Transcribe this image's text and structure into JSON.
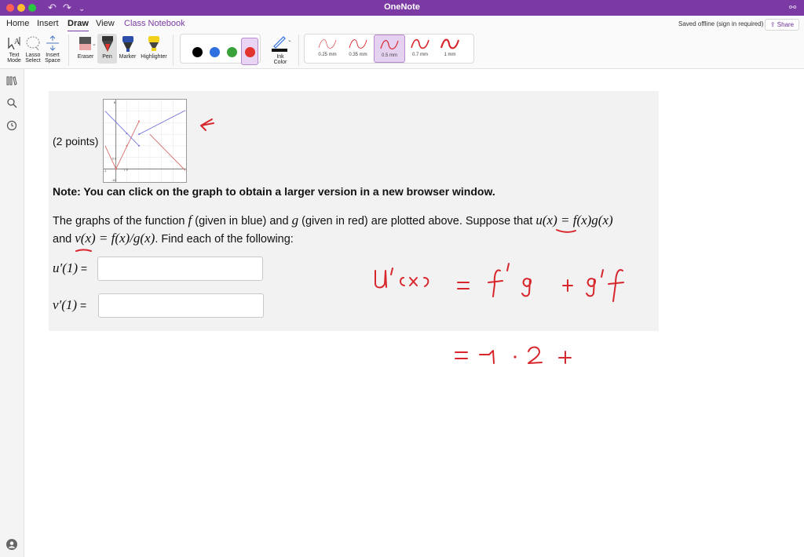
{
  "window": {
    "title": "OneNote"
  },
  "tabs": [
    "Home",
    "Insert",
    "Draw",
    "View",
    "Class Notebook"
  ],
  "active_tab": "Draw",
  "status": {
    "saved": "Saved offline (sign in required)",
    "share": "Share"
  },
  "ribbon": {
    "text_mode": [
      "Text",
      "Mode"
    ],
    "lasso_select": [
      "Lasso",
      "Select"
    ],
    "insert_space": [
      "Insert",
      "Space"
    ],
    "eraser": "Eraser",
    "pen": "Pen",
    "marker": "Marker",
    "highlighter": "Highlighter",
    "ink_color": [
      "Ink",
      "Color"
    ],
    "colors": [
      "#000000",
      "#2f6fe0",
      "#3aa23a",
      "#e2332c"
    ],
    "selected_color": "#e2332c",
    "thickness": [
      "0.25 mm",
      "0.35 mm",
      "0.5 mm",
      "0.7 mm",
      "1 mm"
    ],
    "selected_thickness": "0.5 mm"
  },
  "page": {
    "points": "(2 points)",
    "note": "Note: You can click on the graph to obtain a larger version in a new browser window.",
    "p1_a": "The graphs of the function ",
    "f": "f",
    "p1_b": " (given in blue) and ",
    "g": "g",
    "p1_c": " (given in red) are plotted above. Suppose that ",
    "u_def": "u(x) = f(x)g(x)",
    "p2_a": "and ",
    "v_def": "v(x) = f(x)/g(x)",
    "p2_b": ". Find each of the following:",
    "u_prime_label": "u′(1)",
    "v_prime_label": "v′(1)",
    "equals": " ="
  },
  "ink_colors": {
    "red": "#d8262d",
    "blue": "#5b5bd6"
  }
}
